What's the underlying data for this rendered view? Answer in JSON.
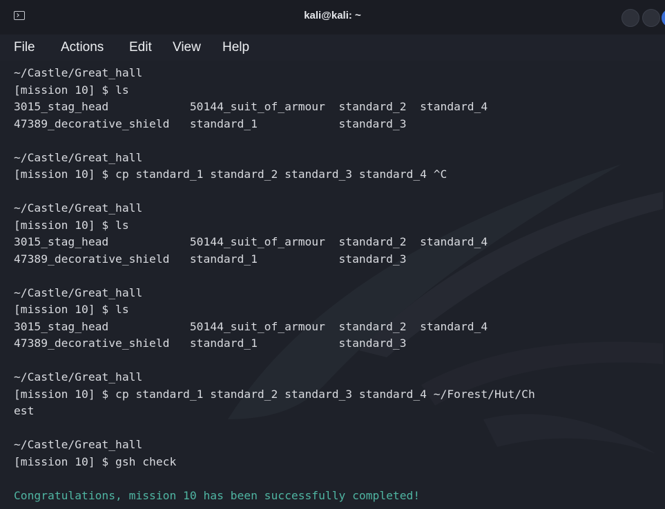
{
  "window": {
    "title": "kali@kali: ~"
  },
  "menu": {
    "file": "File",
    "actions": "Actions",
    "edit": "Edit",
    "view": "View",
    "help": "Help"
  },
  "terminal": {
    "lines": [
      "~/Castle/Great_hall",
      "[mission 10] $ ls",
      "3015_stag_head            50144_suit_of_armour  standard_2  standard_4",
      "47389_decorative_shield   standard_1            standard_3",
      "",
      "~/Castle/Great_hall",
      "[mission 10] $ cp standard_1 standard_2 standard_3 standard_4 ^C",
      "",
      "~/Castle/Great_hall",
      "[mission 10] $ ls",
      "3015_stag_head            50144_suit_of_armour  standard_2  standard_4",
      "47389_decorative_shield   standard_1            standard_3",
      "",
      "~/Castle/Great_hall",
      "[mission 10] $ ls",
      "3015_stag_head            50144_suit_of_armour  standard_2  standard_4",
      "47389_decorative_shield   standard_1            standard_3",
      "",
      "~/Castle/Great_hall",
      "[mission 10] $ cp standard_1 standard_2 standard_3 standard_4 ~/Forest/Hut/Ch",
      "est",
      "",
      "~/Castle/Great_hall",
      "[mission 10] $ gsh check",
      "",
      "Congratulations, mission 10 has been successfully completed!"
    ]
  },
  "colors": {
    "background": "#1e2129",
    "text": "#d9dbe0",
    "success": "#4fb5a2",
    "titlebar": "#1a1c23",
    "accent": "#3a6fd8"
  }
}
